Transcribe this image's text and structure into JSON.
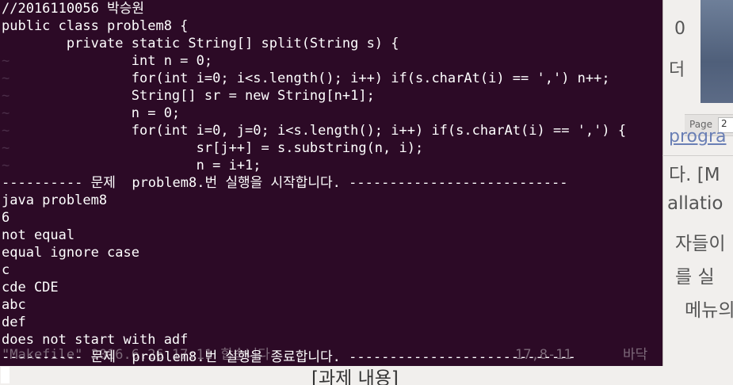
{
  "terminal": {
    "lines": [
      "//2016110056 박승원",
      "public class problem8 {",
      "        private static String[] split(String s) {",
      "                int n = 0;",
      "                for(int i=0; i<s.length(); i++) if(s.charAt(i) == ',') n++;",
      "                String[] sr = new String[n+1];",
      "                n = 0;",
      "                for(int i=0, j=0; i<s.length(); i++) if(s.charAt(i) == ',') {",
      "                        sr[j++] = s.substring(n, i);",
      "                        n = i+1;",
      "---------- 문제  problem8.번 실행을 시작합니다. ---------------------------",
      "java problem8",
      "6",
      "not equal",
      "equal ignore case",
      "c",
      "cde CDE",
      "abc",
      "def",
      "does not start with adf",
      "---------- 문제  problem8.번 실행을 종료합니다. ----------------------------"
    ],
    "tilde": "~",
    "status_filename": "\"Makefile\" 2016.6.26 17:11 합습니다",
    "status_position": "17,8-11",
    "status_scroll": "바닥"
  },
  "background_document": {
    "page_label": "Page",
    "page_value": "2",
    "heading": "[과제 내용]",
    "fragments": [
      "0",
      "더",
      "progra",
      "다. [M",
      "allatio",
      "자들이",
      "를  실",
      "메뉴의"
    ]
  }
}
